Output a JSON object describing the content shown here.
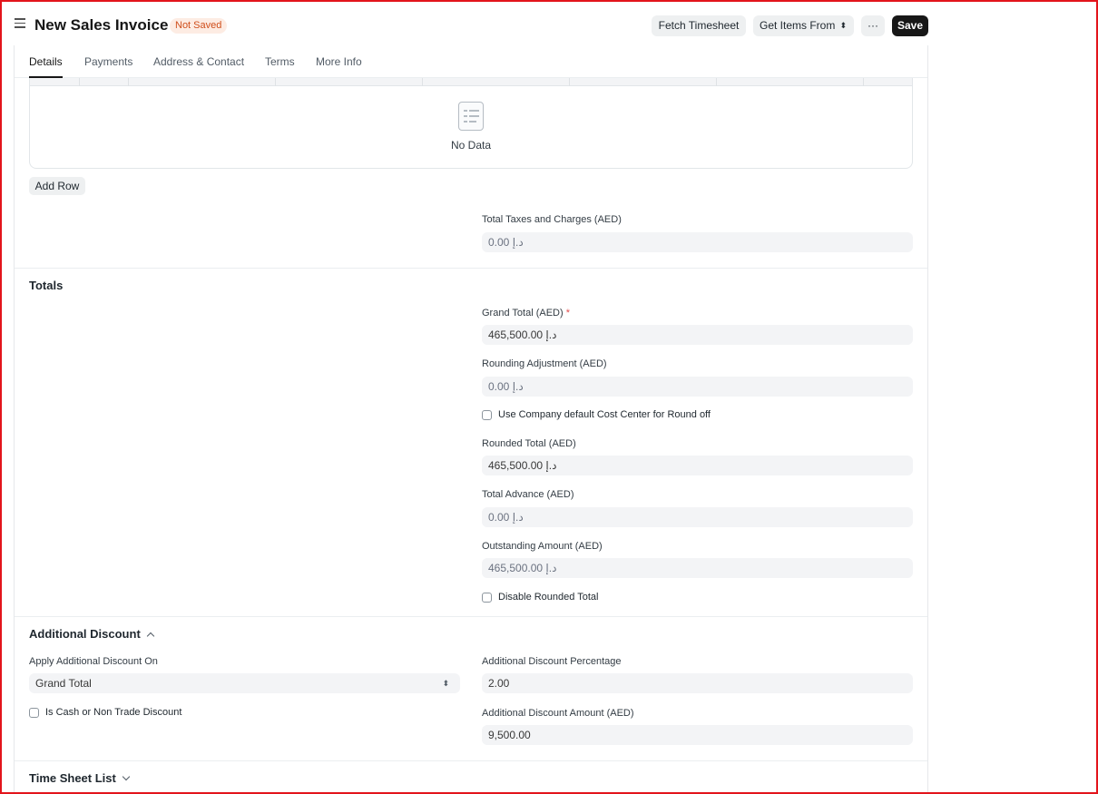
{
  "header": {
    "title": "New Sales Invoice",
    "status_badge": "Not Saved",
    "fetch_timesheet_label": "Fetch Timesheet",
    "get_items_from_label": "Get Items From",
    "more_label": "···",
    "save_label": "Save"
  },
  "tabs": [
    {
      "label": "Details",
      "active": true
    },
    {
      "label": "Payments"
    },
    {
      "label": "Address & Contact"
    },
    {
      "label": "Terms"
    },
    {
      "label": "More Info"
    }
  ],
  "taxes_table": {
    "empty_text": "No Data",
    "add_row_label": "Add Row",
    "total_taxes_label": "Total Taxes and Charges (AED)",
    "total_taxes_value": "0.00 د.إ"
  },
  "totals": {
    "section_title": "Totals",
    "grand_total_label": "Grand Total (AED)",
    "grand_total_required": "*",
    "grand_total_value": "465,500.00 د.إ",
    "rounding_adjustment_label": "Rounding Adjustment (AED)",
    "rounding_adjustment_value": "0.00 د.إ",
    "use_company_cost_center_label": "Use Company default Cost Center for Round off",
    "rounded_total_label": "Rounded Total (AED)",
    "rounded_total_value": "465,500.00 د.إ",
    "total_advance_label": "Total Advance (AED)",
    "total_advance_value": "0.00 د.إ",
    "outstanding_amount_label": "Outstanding Amount (AED)",
    "outstanding_amount_value": "465,500.00 د.إ",
    "disable_rounded_total_label": "Disable Rounded Total"
  },
  "additional_discount": {
    "section_title": "Additional Discount",
    "apply_on_label": "Apply Additional Discount On",
    "apply_on_value": "Grand Total",
    "is_cash_label": "Is Cash or Non Trade Discount",
    "percentage_label": "Additional Discount Percentage",
    "percentage_value": "2.00",
    "amount_label": "Additional Discount Amount (AED)",
    "amount_value": "9,500.00"
  },
  "time_sheet": {
    "section_title": "Time Sheet List"
  },
  "colors": {
    "primary_button": "#171717",
    "badge_bg": "#fdece3",
    "badge_text": "#cf4e1b",
    "frame_border": "#e3141b"
  }
}
